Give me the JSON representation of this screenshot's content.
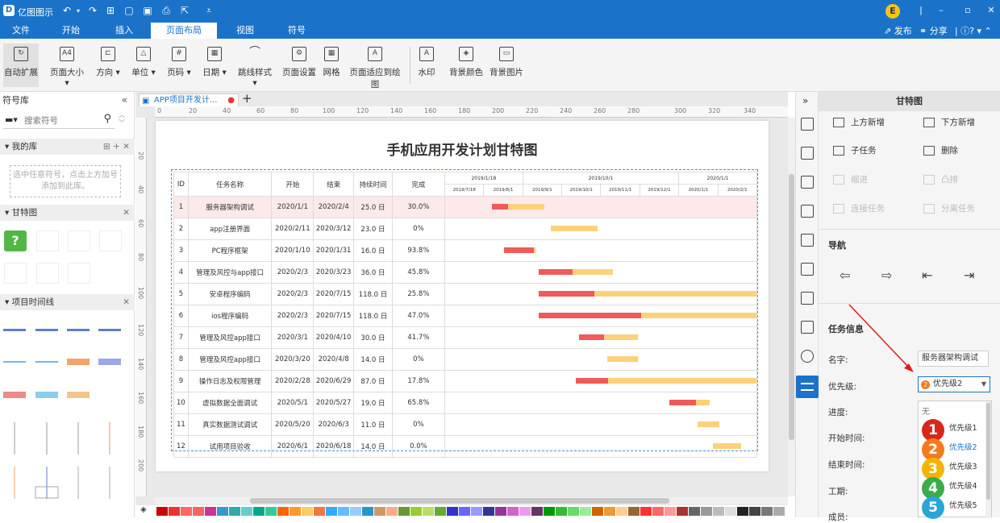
{
  "app": {
    "title": "亿图图示",
    "logo": "D"
  },
  "ribbon_tabs": [
    "文件",
    "开始",
    "插入",
    "页面布局",
    "视图",
    "符号"
  ],
  "share": {
    "publish": "发布",
    "share": "分享",
    "help": "?"
  },
  "user_initial": "E",
  "ribbon": [
    "自动扩展",
    "页面大小",
    "方向",
    "单位",
    "页码",
    "日期",
    "跳线样式",
    "页面设置",
    "网格",
    "页面适应到绘图",
    "水印",
    "背景颜色",
    "背景图片"
  ],
  "left": {
    "title": "符号库",
    "search_placeholder": "搜索符号",
    "my_lib": "我的库",
    "drop_hint": "选中任意符号，点击上方加号添加到此库。",
    "gantt": "甘特图",
    "timeline": "项目时间线"
  },
  "doc_tab": "APP项目开发计...",
  "ruler_h": [
    "0",
    "20",
    "40",
    "60",
    "80",
    "100",
    "120",
    "140",
    "160",
    "180",
    "200",
    "220",
    "240",
    "260",
    "280",
    "300",
    "320",
    "340"
  ],
  "ruler_v": [
    "20",
    "40",
    "60",
    "80",
    "100",
    "120",
    "140",
    "160",
    "180",
    "200"
  ],
  "chart": {
    "title": "手机应用开发计划甘特图",
    "headers": [
      "ID",
      "任务名称",
      "开始",
      "结束",
      "持续时间",
      "完成"
    ],
    "months": [
      "2019/1/18",
      "2019/10/1",
      "2020/1/1"
    ],
    "dates": [
      "2019/7/18",
      "2019/8/1",
      "2019/9/1",
      "2019/10/1",
      "2019/11/1",
      "2019/12/1",
      "2020/1/1",
      "2020/2/1"
    ],
    "rows": [
      {
        "id": "1",
        "name": "服务器架构调试",
        "start": "2020/1/1",
        "end": "2020/2/4",
        "dur": "25.0 日",
        "pct": "30.0%",
        "bar": [
          0.15,
          0.32
        ],
        "done": 0.3
      },
      {
        "id": "2",
        "name": "app注册界面",
        "start": "2020/2/11",
        "end": "2020/3/12",
        "dur": "23.0 日",
        "pct": "0%",
        "bar": [
          0.34,
          0.49
        ],
        "done": 0
      },
      {
        "id": "3",
        "name": "PC程序框架",
        "start": "2020/1/10",
        "end": "2020/1/31",
        "dur": "16.0 日",
        "pct": "93.8%",
        "bar": [
          0.19,
          0.29
        ],
        "done": 0.938
      },
      {
        "id": "4",
        "name": "管理及风控与app接口",
        "start": "2020/2/3",
        "end": "2020/3/23",
        "dur": "36.0 日",
        "pct": "45.8%",
        "bar": [
          0.3,
          0.54
        ],
        "done": 0.458
      },
      {
        "id": "5",
        "name": "安卓程序编码",
        "start": "2020/2/3",
        "end": "2020/7/15",
        "dur": "118.0 日",
        "pct": "25.8%",
        "bar": [
          0.3,
          1.0
        ],
        "done": 0.258
      },
      {
        "id": "6",
        "name": "ios程序编码",
        "start": "2020/2/3",
        "end": "2020/7/15",
        "dur": "118.0 日",
        "pct": "47.0%",
        "bar": [
          0.3,
          1.0
        ],
        "done": 0.47
      },
      {
        "id": "7",
        "name": "管理及风控app接口",
        "start": "2020/3/1",
        "end": "2020/4/10",
        "dur": "30.0 日",
        "pct": "41.7%",
        "bar": [
          0.43,
          0.62
        ],
        "done": 0.417
      },
      {
        "id": "8",
        "name": "管理及风控app接口",
        "start": "2020/3/20",
        "end": "2020/4/8",
        "dur": "14.0 日",
        "pct": "0%",
        "bar": [
          0.52,
          0.62
        ],
        "done": 0
      },
      {
        "id": "9",
        "name": "操作日志及权限管理",
        "start": "2020/2/28",
        "end": "2020/6/29",
        "dur": "87.0 日",
        "pct": "17.8%",
        "bar": [
          0.42,
          1.0
        ],
        "done": 0.178
      },
      {
        "id": "10",
        "name": "虚拟数据全面调试",
        "start": "2020/5/1",
        "end": "2020/5/27",
        "dur": "19.0 日",
        "pct": "65.8%",
        "bar": [
          0.72,
          0.85
        ],
        "done": 0.658
      },
      {
        "id": "11",
        "name": "真实数据测试调试",
        "start": "2020/5/20",
        "end": "2020/6/3",
        "dur": "11.0 日",
        "pct": "0%",
        "bar": [
          0.81,
          0.88
        ],
        "done": 0
      },
      {
        "id": "12",
        "name": "试用项目验收",
        "start": "2020/6/1",
        "end": "2020/6/18",
        "dur": "14.0 日",
        "pct": "0.0%",
        "bar": [
          0.86,
          0.95
        ],
        "done": 0
      }
    ]
  },
  "right": {
    "title": "甘特图",
    "btns": [
      "上方新增",
      "下方新增",
      "子任务",
      "删除",
      "缩进",
      "凸排",
      "连接任务",
      "分离任务"
    ],
    "nav": "导航",
    "task_info": "任务信息",
    "name_label": "名字:",
    "name_value": "服务器架构调试",
    "priority_label": "优先级:",
    "priority_value": "优先级2",
    "priority_num": "2",
    "progress": "进度:",
    "start": "开始时间:",
    "end": "结束时间:",
    "duration": "工期:",
    "assignee": "成员:",
    "dropdown_none": "无",
    "dropdown": [
      {
        "n": "1",
        "label": "优先级1",
        "color": "#d9261c"
      },
      {
        "n": "2",
        "label": "优先级2",
        "color": "#f47a20"
      },
      {
        "n": "3",
        "label": "优先级3",
        "color": "#f5b400"
      },
      {
        "n": "4",
        "label": "优先级4",
        "color": "#3cab4a"
      },
      {
        "n": "5",
        "label": "优先级5",
        "color": "#2aa6d6"
      }
    ]
  },
  "colors": {
    "accent": "#1a73c8",
    "done": "#f05a5a",
    "todo": "#fdd17c"
  }
}
